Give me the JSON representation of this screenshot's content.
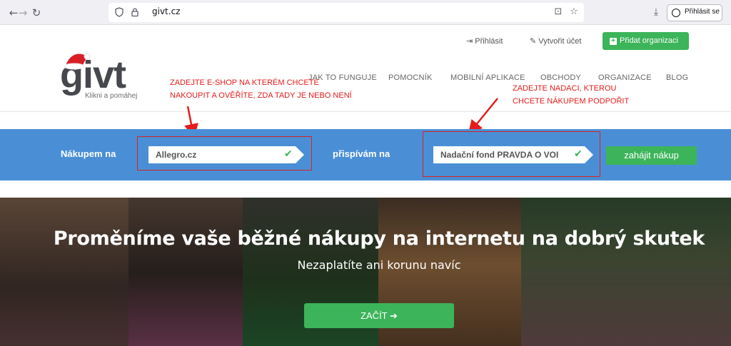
{
  "browser": {
    "url": "givt.cz",
    "signin_label": "Přihlásit se",
    "icons": [
      "back-arrow-icon",
      "forward-arrow-icon",
      "reload-icon",
      "shield-icon",
      "lock-icon",
      "install-icon",
      "bookmark-star-icon",
      "download-icon",
      "account-icon",
      "menu-icon"
    ]
  },
  "header": {
    "top_links": {
      "login": "Přihlásit",
      "create_account": "Vytvořit účet",
      "add_org": "Přidat organizaci"
    },
    "logo": {
      "word": "givt",
      "tagline": "Klikni a pomáhej"
    },
    "nav": [
      "JAK TO FUNGUJE",
      "POMOCNÍK",
      "MOBILNÍ APLIKACE",
      "OBCHODY",
      "ORGANIZACE",
      "BLOG"
    ]
  },
  "annotations": {
    "left_line1": "ZADEJTE E-SHOP NA KTERÉM CHCETE",
    "left_line2": "NAKOUPIT A OVĚŘÍTE, ZDA TADY JE NEBO NENÍ",
    "right_line1": "ZADEJTE NADACI, KTEROU",
    "right_line2": "CHCETE NÁKUPEM PODPOŘIT"
  },
  "search": {
    "label_shop": "Nákupem na",
    "shop_value": "Allegro.cz",
    "label_org": "přispívám na",
    "org_value": "Nadační fond PRAVDA O VOI",
    "start_button": "zahájit nákup"
  },
  "hero": {
    "title": "Proměníme vaše běžné nákupy na internetu na dobrý skutek",
    "subtitle": "Nezaplatíte ani korunu navíc",
    "cta": "ZAČÍT"
  },
  "colors": {
    "green": "#3cb45a",
    "blue_band": "#4a8fd6",
    "annotation_red": "#e51c1c"
  }
}
